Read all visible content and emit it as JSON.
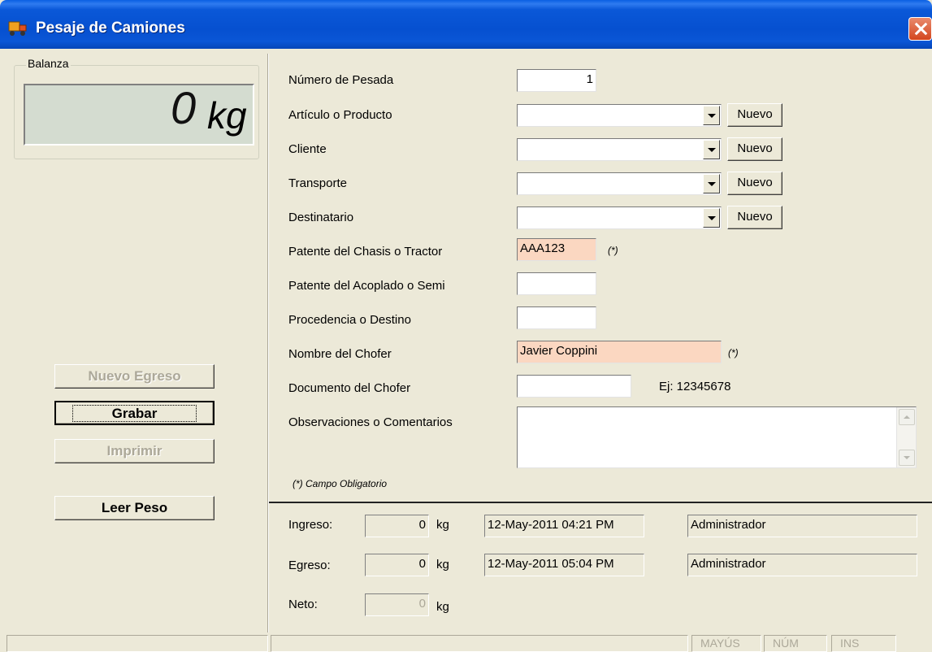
{
  "window": {
    "title": "Pesaje de Camiones"
  },
  "balanza": {
    "label": "Balanza",
    "value": "0",
    "unit": "kg"
  },
  "actions": {
    "nuevo_egreso": "Nuevo Egreso",
    "grabar": "Grabar",
    "imprimir": "Imprimir",
    "leer_peso": "Leer Peso"
  },
  "form": {
    "numero_pesada": {
      "label": "Número de Pesada",
      "value": "1"
    },
    "articulo": {
      "label": "Artículo o Producto",
      "value": "",
      "button": "Nuevo"
    },
    "cliente": {
      "label": "Cliente",
      "value": "",
      "button": "Nuevo"
    },
    "transporte": {
      "label": "Transporte",
      "value": "",
      "button": "Nuevo"
    },
    "destinatario": {
      "label": "Destinatario",
      "value": "",
      "button": "Nuevo"
    },
    "patente_chasis": {
      "label": "Patente del Chasis o Tractor",
      "value": "AAA123",
      "required": "(*)"
    },
    "patente_acoplado": {
      "label": "Patente del Acoplado o Semi",
      "value": ""
    },
    "procedencia": {
      "label": "Procedencia o Destino",
      "value": ""
    },
    "nombre_chofer": {
      "label": "Nombre del Chofer",
      "value": "Javier Coppini",
      "required": "(*)"
    },
    "documento_chofer": {
      "label": "Documento del Chofer",
      "value": "",
      "hint": "Ej: 12345678"
    },
    "observaciones": {
      "label": "Observaciones o Comentarios",
      "value": ""
    },
    "required_note": "(*) Campo Obligatorio"
  },
  "pesadas": {
    "ingreso": {
      "label": "Ingreso:",
      "kg": "0",
      "unit": "kg",
      "fecha": "12-May-2011 04:21 PM",
      "usuario": "Administrador"
    },
    "egreso": {
      "label": "Egreso:",
      "kg": "0",
      "unit": "kg",
      "fecha": "12-May-2011 05:04 PM",
      "usuario": "Administrador"
    },
    "neto": {
      "label": "Neto:",
      "kg": "0",
      "unit": "kg"
    }
  },
  "statusbar": {
    "mayus": "MAYÚS",
    "num": "NÚM",
    "ins": "INS"
  }
}
